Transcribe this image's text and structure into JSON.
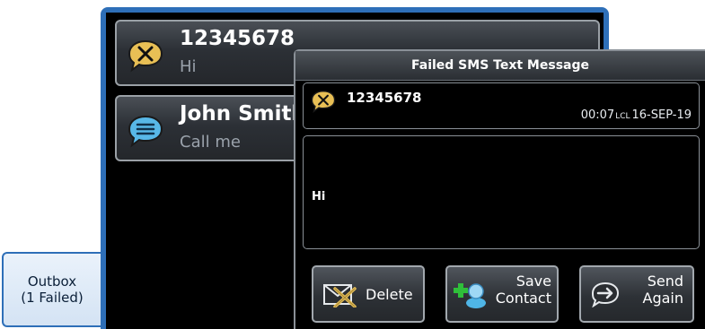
{
  "outbox_tab": {
    "line1": "Outbox",
    "line2": "(1 Failed)"
  },
  "messages": [
    {
      "name": "12345678",
      "preview": "Hi",
      "status_icon": "failed-message-icon"
    },
    {
      "name": "John Smith",
      "preview": "Call me",
      "status_icon": "message-bubble-icon"
    }
  ],
  "dialog": {
    "title": "Failed SMS Text Message",
    "sender": "12345678",
    "time": "00:07",
    "time_zone": "LCL",
    "date": "16-SEP-19",
    "body": "Hi",
    "buttons": {
      "delete": {
        "label": "Delete",
        "icon": "delete-envelope-icon"
      },
      "save_contact": {
        "line1": "Save",
        "line2": "Contact",
        "icon": "add-contact-icon"
      },
      "send_again": {
        "line1": "Send",
        "line2": "Again",
        "icon": "resend-arrow-icon"
      }
    }
  },
  "colors": {
    "frame_blue": "#2e6fb8",
    "failed_icon": "#e8bf55",
    "message_icon": "#58b8e8",
    "add_green": "#2fbf3a"
  }
}
